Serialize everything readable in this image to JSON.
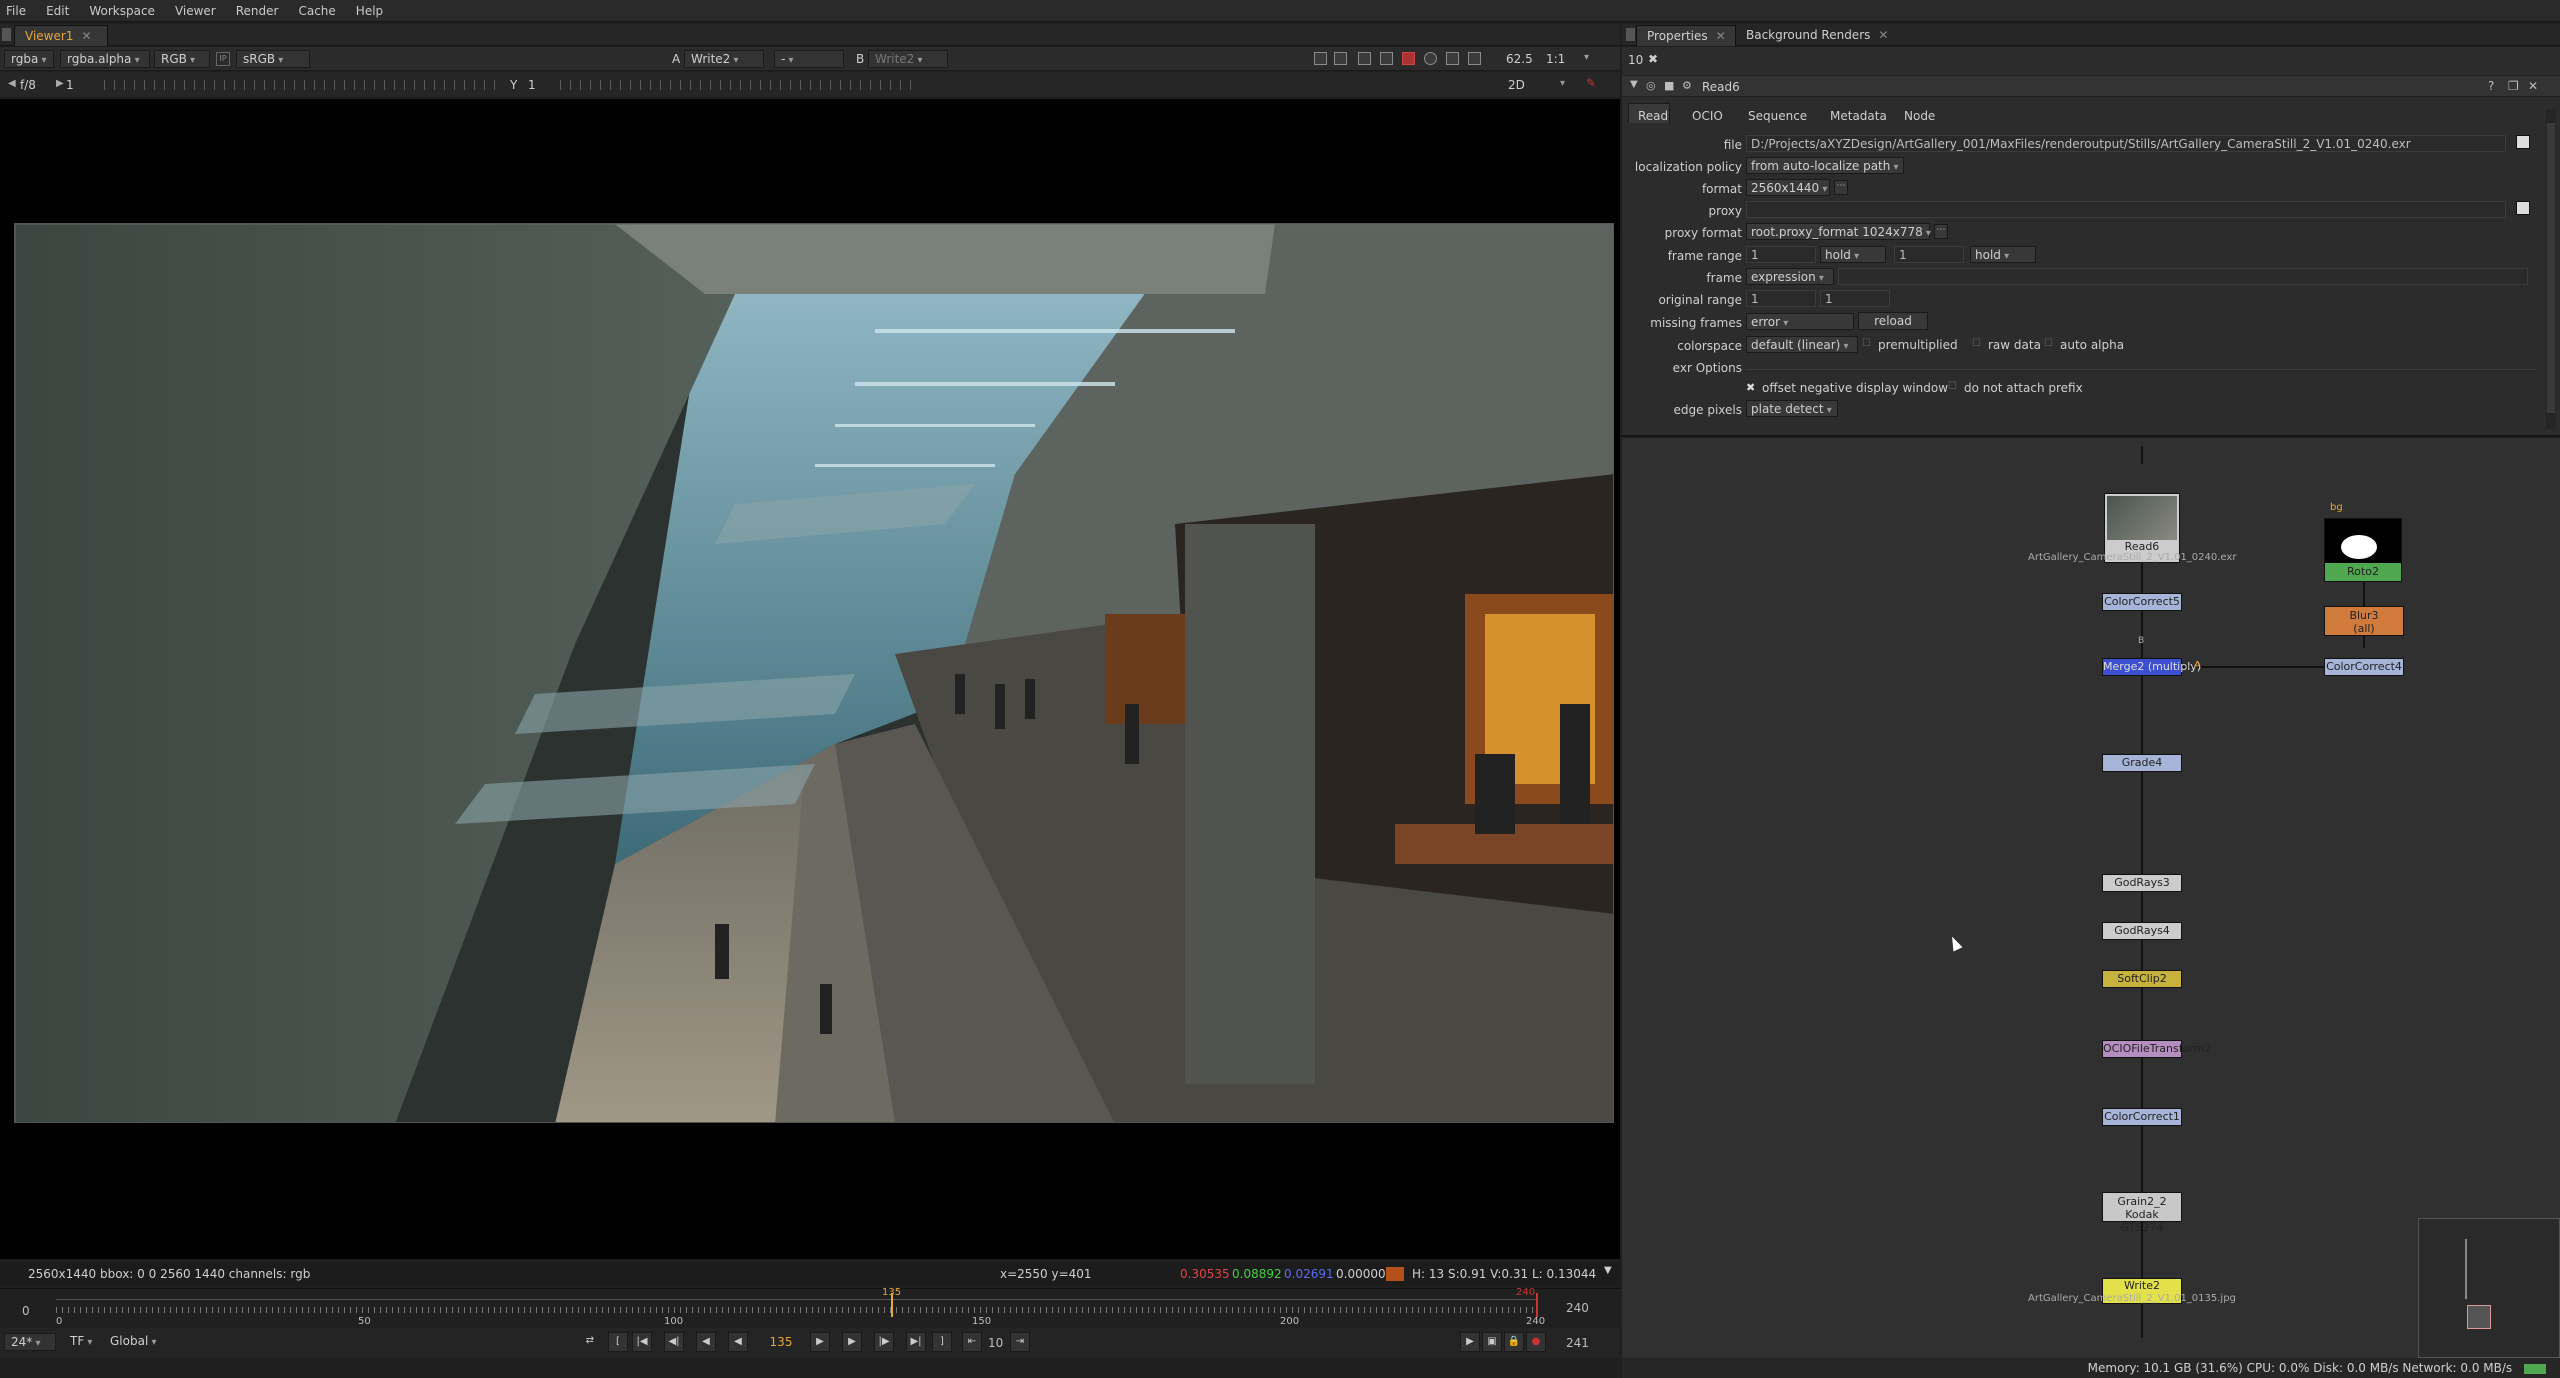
{
  "menu": [
    "File",
    "Edit",
    "Workspace",
    "Viewer",
    "Render",
    "Cache",
    "Help"
  ],
  "viewer": {
    "tab_label": "Viewer1",
    "channels": "rgba",
    "alpha": "rgba.alpha",
    "rgb": "RGB",
    "lut": "sRGB",
    "a_input": "Write2",
    "a_blend": "-",
    "b_input": "Write2",
    "a_tag": "A",
    "b_tag": "B",
    "gain_label": "f/8",
    "gain_value": "1",
    "gamma_label": "Y",
    "gamma_value": "1",
    "zoom": "62.5",
    "ratio": "1:1",
    "mode": "2D"
  },
  "viewer_status": {
    "format": "2560x1440",
    "bbox": "bbox: 0 0 2560 1440 channels: rgb",
    "coords": "x=2550 y=401",
    "r": "0.30535",
    "g": "0.08892",
    "b": "0.02691",
    "a": "0.00000",
    "hsv": "H: 13 S:0.91 V:0.31  L: 0.13044"
  },
  "timeline": {
    "start": "0",
    "end": "240",
    "ticks": [
      "0",
      "50",
      "100",
      "150",
      "200",
      "240"
    ],
    "current_marker": "135",
    "end_marker": "240",
    "fps": "24*",
    "tf": "TF",
    "range_mode": "Global",
    "current_frame": "135",
    "step": "10",
    "total": "241"
  },
  "properties": {
    "tabs": [
      "Properties",
      "Background Renders"
    ],
    "count": "10",
    "node_name": "Read6",
    "subtabs": [
      "Read",
      "OCIO",
      "Sequence",
      "Metadata",
      "Node"
    ],
    "file_label": "file",
    "file_value": "D:/Projects/aXYZDesign/ArtGallery_001/MaxFiles/renderoutput/Stills/ArtGallery_CameraStill_2_V1.01_0240.exr",
    "localization_label": "localization policy",
    "localization_value": "from auto-localize path",
    "format_label": "format",
    "format_value": "2560x1440",
    "proxy_label": "proxy",
    "proxy_format_label": "proxy format",
    "proxy_format_value": "root.proxy_format 1024x778",
    "frame_range_label": "frame range",
    "frame_range_start": "1",
    "frame_range_before": "hold",
    "frame_range_end": "1",
    "frame_range_after": "hold",
    "frame_label": "frame",
    "frame_mode": "expression",
    "original_range_label": "original range",
    "original_start": "1",
    "original_end": "1",
    "missing_frames_label": "missing frames",
    "missing_frames_value": "error",
    "reload_label": "reload",
    "colorspace_label": "colorspace",
    "colorspace_value": "default (linear)",
    "premultiplied_label": "premultiplied",
    "raw_data_label": "raw data",
    "auto_alpha_label": "auto alpha",
    "exr_options_label": "exr Options",
    "offset_label": "offset negative display window",
    "no_prefix_label": "do not attach prefix",
    "edge_pixels_label": "edge pixels",
    "edge_pixels_value": "plate detect"
  },
  "nodes": {
    "read6": "Read6",
    "read6_label": "ArtGallery_CameraStill_2_V1.01_0240.exr",
    "colorcorrect5": "ColorCorrect5",
    "merge": "Merge2 (multiply)",
    "merge_a": "A",
    "merge_b": "B",
    "roto2": "Roto2",
    "roto_bg": "bg",
    "blur3": "Blur3",
    "blur3_sub": "(all)",
    "colorcorrect4": "ColorCorrect4",
    "grade4": "Grade4",
    "godrays3": "GodRays3",
    "godrays4": "GodRays4",
    "softclip2": "SoftClip2",
    "ociofiletransform": "OCIOFileTransform2",
    "colorcorrect1": "ColorCorrect1",
    "grain": "Grain2_2",
    "grain_sub": "Kodak GT5274",
    "write2": "Write2",
    "write2_label": "ArtGallery_CameraStill_2_V1.01_0135.jpg"
  },
  "status": {
    "memory": "Memory: 10.1 GB (31.6%)  CPU: 0.0%  Disk: 0.0 MB/s  Network: 0.0 MB/s"
  }
}
